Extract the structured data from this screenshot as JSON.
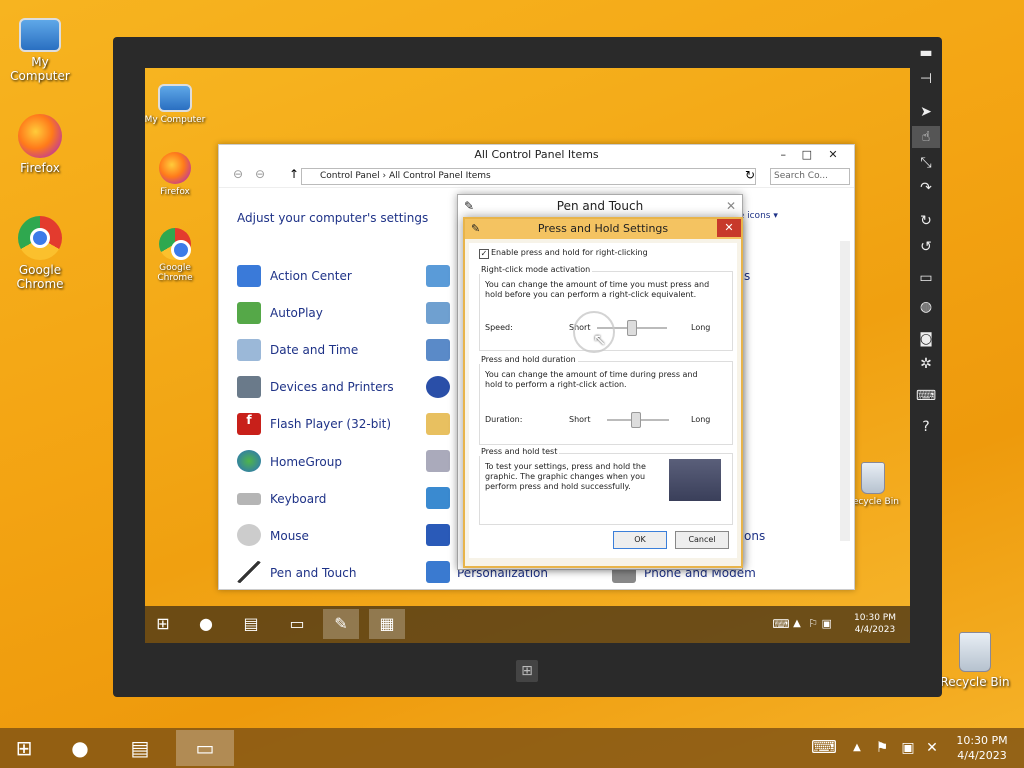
{
  "desktop": {
    "icons": [
      {
        "label": "My Computer"
      },
      {
        "label": "Firefox"
      },
      {
        "label": "Google Chrome"
      },
      {
        "label": "Recycle Bin"
      }
    ]
  },
  "tablet": {
    "desktop_icons": [
      {
        "label": "My Computer"
      },
      {
        "label": "Firefox"
      },
      {
        "label": "Google Chrome"
      },
      {
        "label": "Recycle Bin"
      }
    ],
    "sidebar": [
      "minimize-icon",
      "pin-icon",
      "pointer-icon",
      "hand-icon",
      "pinch-icon",
      "rotate-gesture-icon",
      "rotate-cw-icon",
      "rotate-ccw-icon",
      "monitor-icon",
      "globe-icon",
      "camera-icon",
      "gear-icon",
      "keyboard-icon",
      "help-icon"
    ],
    "clock": {
      "time": "10:30 PM",
      "date": "4/4/2023"
    }
  },
  "control_panel": {
    "title": "All Control Panel Items",
    "breadcrumb": [
      "Control Panel",
      "All Control Panel Items"
    ],
    "search_placeholder": "Search Co...",
    "heading": "Adjust your computer's settings",
    "view_by": "ge icons ▾",
    "items_col1": [
      "Action Center",
      "AutoPlay",
      "Date and Time",
      "Devices and Printers",
      "Flash Player (32-bit)",
      "HomeGroup",
      "Keyboard",
      "Mouse",
      "Pen and Touch"
    ],
    "items_col2_visible": [
      "Personalization"
    ],
    "items_col3_visible": [
      "Phone and Modem"
    ],
    "partial_right": [
      "s",
      "ons"
    ]
  },
  "pen_touch": {
    "title": "Pen and Touch"
  },
  "press_hold": {
    "title": "Press and Hold Settings",
    "checkbox_label": "Enable press and hold for right-clicking",
    "checked": true,
    "group1": {
      "title": "Right-click mode activation",
      "text": "You can change the amount of time you must press and hold before you can perform a right-click equivalent.",
      "label": "Speed:",
      "short": "Short",
      "long": "Long",
      "value": 0.25
    },
    "group2": {
      "title": "Press and hold duration",
      "text": "You can change the amount of time during press and hold to perform a right-click action.",
      "label": "Duration:",
      "short": "Short",
      "long": "Long",
      "value": 0.5
    },
    "group3": {
      "title": "Press and hold test",
      "text": "To test your settings, press and hold the graphic. The graphic changes when you perform press and hold successfully."
    },
    "ok": "OK",
    "cancel": "Cancel"
  },
  "taskbar": {
    "clock": {
      "time": "10:30 PM",
      "date": "4/4/2023"
    }
  }
}
